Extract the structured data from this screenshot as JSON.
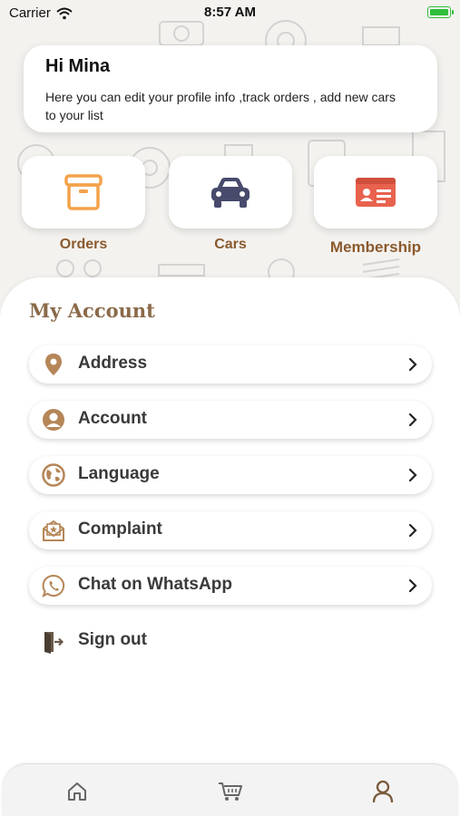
{
  "status_bar": {
    "carrier": "Carrier",
    "time": "8:57 AM"
  },
  "greeting": {
    "title": "Hi Mina",
    "text": "Here you can edit your profile info ,track orders , add new cars to your list"
  },
  "tiles": [
    {
      "label": "Orders",
      "icon": "box-icon",
      "color": "#f3a24b"
    },
    {
      "label": "Cars",
      "icon": "car-icon",
      "color": "#474a6b"
    },
    {
      "label": "Membership",
      "icon": "id-card-icon",
      "color": "#e8624e"
    }
  ],
  "account": {
    "title": "My Account",
    "items": [
      {
        "label": "Address",
        "icon": "location-pin-icon"
      },
      {
        "label": "Account",
        "icon": "user-circle-icon"
      },
      {
        "label": "Language",
        "icon": "globe-icon"
      },
      {
        "label": "Complaint",
        "icon": "envelope-icon"
      },
      {
        "label": "Chat on WhatsApp",
        "icon": "whatsapp-icon"
      }
    ],
    "signout": {
      "label": "Sign out",
      "icon": "exit-door-icon"
    }
  },
  "tabbar": {
    "tabs": [
      {
        "name": "home",
        "icon": "home-icon",
        "active": false
      },
      {
        "name": "cart",
        "icon": "cart-icon",
        "active": false
      },
      {
        "name": "profile",
        "icon": "user-icon",
        "active": true
      }
    ]
  },
  "colors": {
    "accent_brown": "#8a5a2e",
    "icon_brown": "#b58658",
    "active_tab": "#7a5a3a"
  }
}
